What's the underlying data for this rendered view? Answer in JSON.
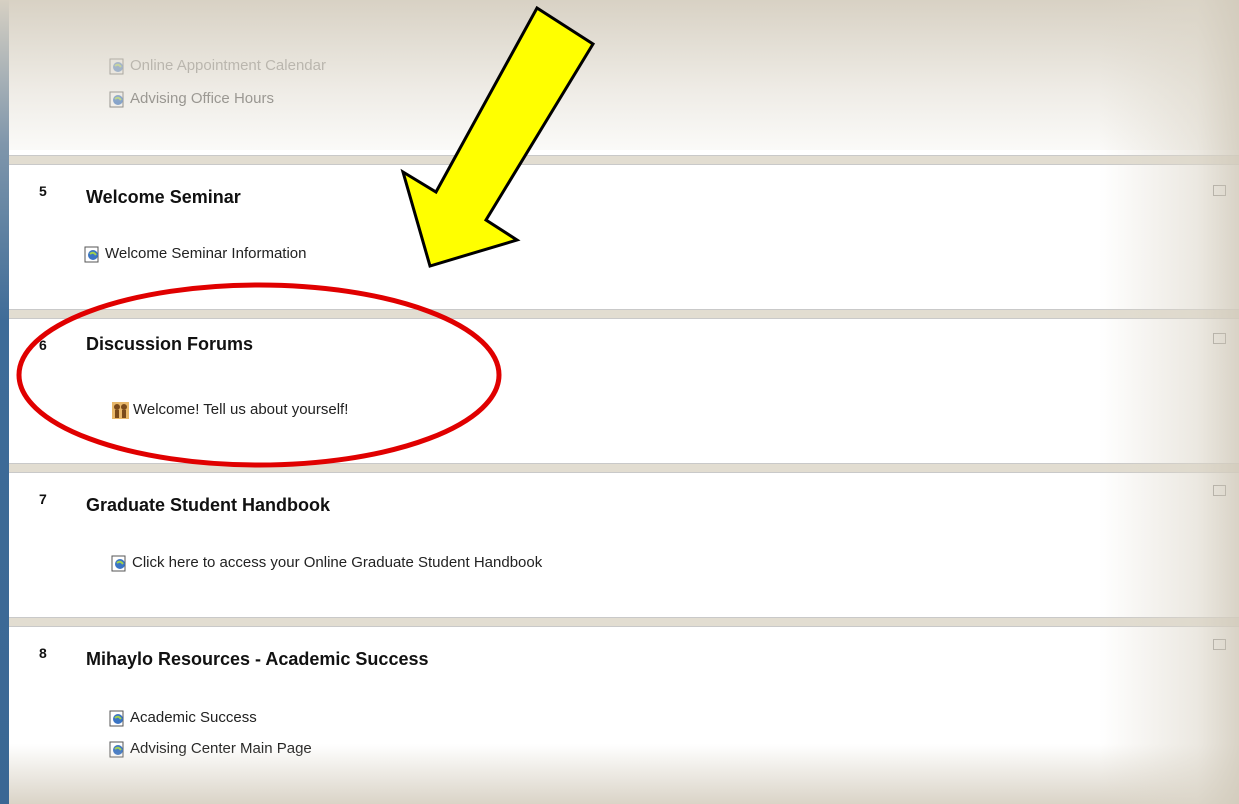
{
  "top_section": {
    "items": [
      {
        "label": "Online Appointment Calendar",
        "icon": "web-page-icon"
      },
      {
        "label": "Advising Office Hours",
        "icon": "web-page-icon"
      }
    ]
  },
  "sections": [
    {
      "number": "5",
      "title": "Welcome Seminar",
      "items": [
        {
          "label": "Welcome Seminar Information",
          "icon": "web-page-icon"
        }
      ]
    },
    {
      "number": "6",
      "title": "Discussion Forums",
      "items": [
        {
          "label": "Welcome! Tell us about yourself!",
          "icon": "forum-icon"
        }
      ]
    },
    {
      "number": "7",
      "title": "Graduate Student Handbook",
      "items": [
        {
          "label": "Click here to access your Online Graduate Student Handbook",
          "icon": "web-page-icon"
        }
      ]
    },
    {
      "number": "8",
      "title": "Mihaylo Resources - Academic Success",
      "items": [
        {
          "label": "Academic Success",
          "icon": "web-page-icon"
        },
        {
          "label": "Advising Center Main Page",
          "icon": "web-page-icon"
        }
      ]
    }
  ],
  "annotations": {
    "arrow_color": "#ffff00",
    "circle_color": "#e00000"
  }
}
